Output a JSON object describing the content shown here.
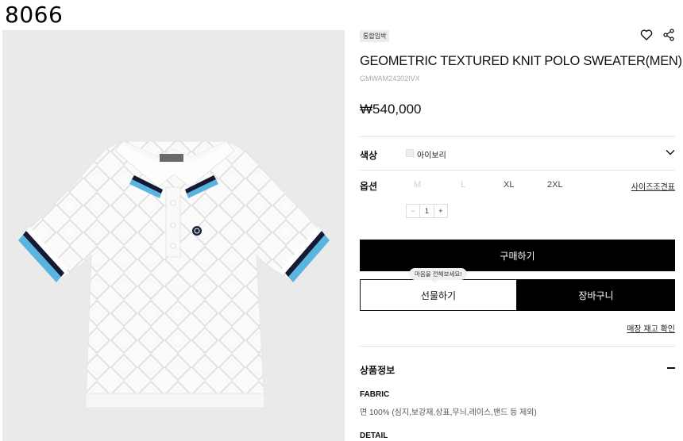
{
  "page_label": "8066",
  "product": {
    "badge": "통합임박",
    "title": "GEOMETRIC TEXTURED KNIT POLO SWEATER(MEN)",
    "code": "GMWAM24302IVX",
    "price": "₩540,000"
  },
  "color_option": {
    "label": "색상",
    "value": "아이보리",
    "swatch_color": "#f1efe9"
  },
  "size_option": {
    "label": "옵션",
    "sizes": [
      "M",
      "L",
      "XL",
      "2XL"
    ],
    "size_guide": "사이즈조견표"
  },
  "quantity": {
    "minus": "−",
    "value": "1",
    "plus": "+"
  },
  "actions": {
    "buy": "구매하기",
    "gift": "선물하기",
    "gift_tooltip": "마음을 전해보세요!",
    "cart": "장바구니",
    "stock_check": "매장 재고 확인"
  },
  "product_info": {
    "title": "상품정보",
    "fabric_title": "FABRIC",
    "fabric_text": "면 100% (심지,보강재,상표,무늬,레이스,밴드 등 제외)",
    "detail_title": "DETAIL"
  },
  "icons": {
    "wishlist": "heart-icon",
    "share": "share-icon",
    "dropdown": "chevron-down-icon",
    "collapse": "minus-icon"
  },
  "colors": {
    "primary_button": "#000000",
    "image_background": "#eaeaea",
    "trim_blue": "#5ab4e0",
    "trim_navy": "#141a33"
  }
}
